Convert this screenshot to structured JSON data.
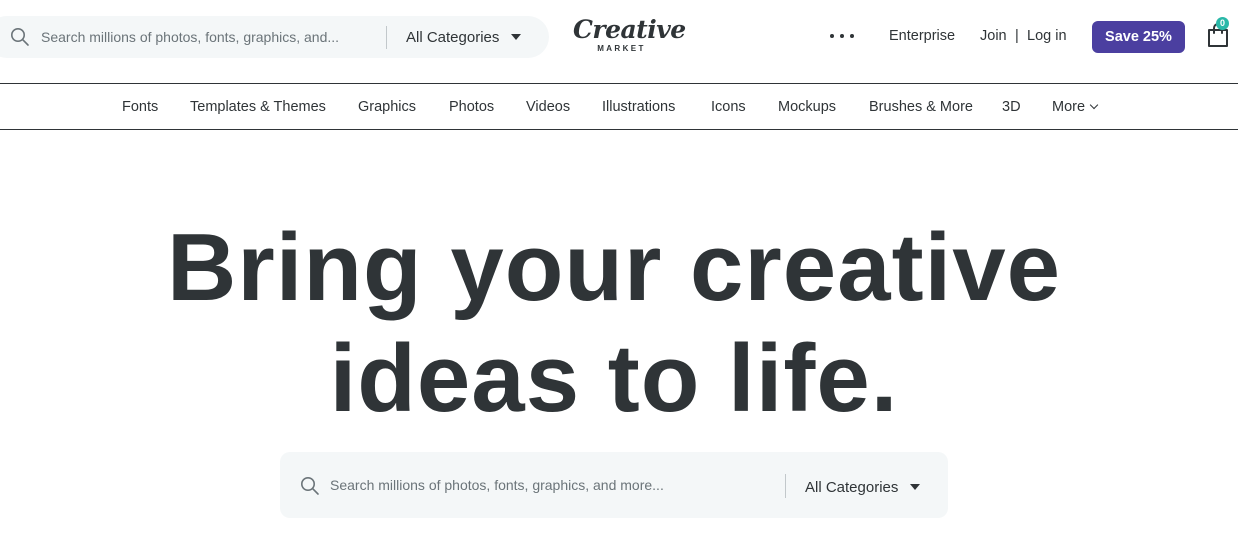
{
  "header": {
    "search": {
      "placeholder": "Search millions of photos, fonts, graphics, and...",
      "category_label": "All Categories"
    },
    "logo": {
      "word": "Creative",
      "sub": "MARKET"
    },
    "more_icon": "ellipsis-icon",
    "links": {
      "enterprise": "Enterprise",
      "join": "Join",
      "separator": "|",
      "login": "Log in"
    },
    "save_button": "Save 25%",
    "cart": {
      "icon": "shopping-bag-icon",
      "count": "0"
    }
  },
  "category_nav": {
    "items": [
      "Fonts",
      "Templates & Themes",
      "Graphics",
      "Photos",
      "Videos",
      "Illustrations",
      "Icons",
      "Mockups",
      "Brushes & More",
      "3D",
      "More"
    ]
  },
  "hero": {
    "title_line1": "Bring your creative",
    "title_line2": "ideas to life.",
    "search": {
      "placeholder": "Search millions of photos, fonts, graphics, and more...",
      "category_label": "All Categories"
    }
  },
  "colors": {
    "text": "#2f3437",
    "accent": "#4b3fa0",
    "badge": "#2ab8a8",
    "search_bg": "#f4f7f8"
  }
}
